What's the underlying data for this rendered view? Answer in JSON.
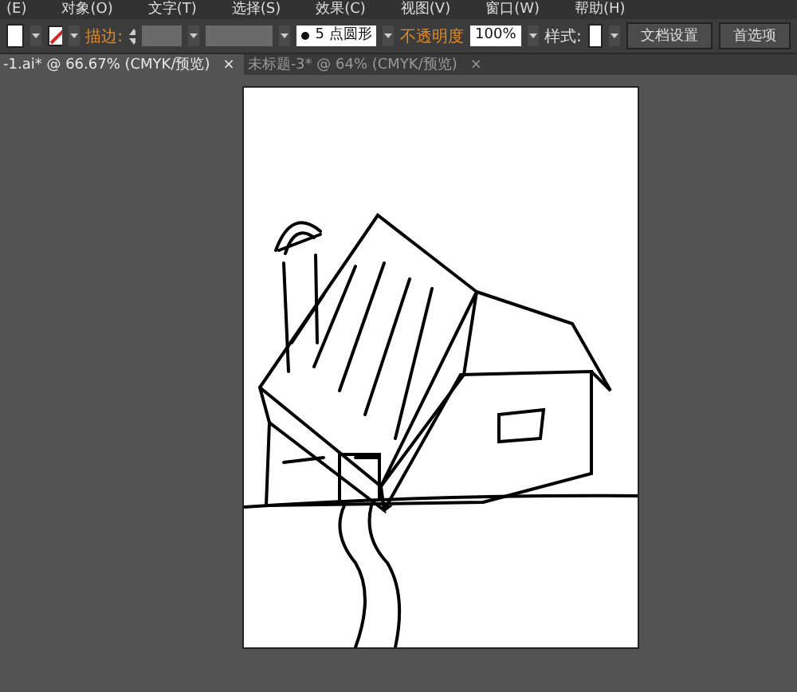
{
  "menu": [
    "(E)",
    "对象(O)",
    "文字(T)",
    "选择(S)",
    "效果(C)",
    "视图(V)",
    "窗口(W)",
    "帮助(H)"
  ],
  "control_bar": {
    "stroke_label": "描边:",
    "brush": "5 点圆形",
    "opacity_label": "不透明度",
    "opacity": "100%",
    "style_label": "样式:",
    "buttons": [
      "文档设置",
      "首选项"
    ]
  },
  "tabs": [
    {
      "label": "-1.ai* @ 66.67% (CMYK/预览)",
      "close": "×",
      "selected": true
    },
    {
      "label": "未标题-3* @ 64% (CMYK/预览)",
      "close": "×",
      "selected": false
    }
  ]
}
